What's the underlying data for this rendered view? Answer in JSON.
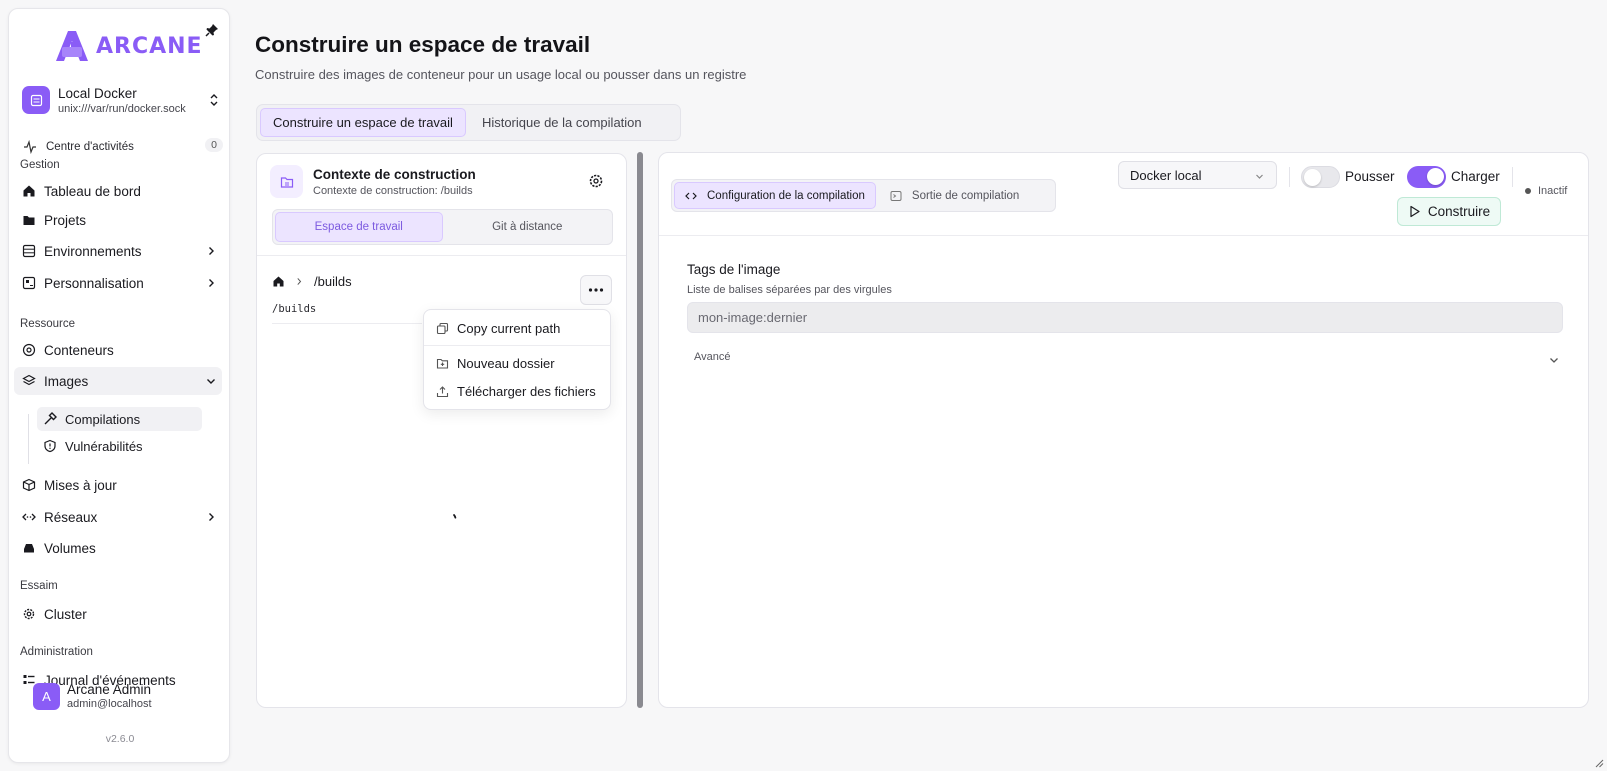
{
  "app": {
    "logo_text": "ARCANE",
    "brand_color": "#8a5cf6"
  },
  "sidebar": {
    "environment": {
      "name": "Local Docker",
      "socket": "unix:///var/run/docker.sock"
    },
    "activity": {
      "label": "Centre d'activités",
      "count": "0"
    },
    "sections": {
      "gestion": "Gestion",
      "ressource": "Ressource",
      "essaim": "Essaim",
      "administration": "Administration"
    },
    "items": {
      "dashboard": "Tableau de bord",
      "projects": "Projets",
      "environments": "Environnements",
      "customization": "Personnalisation",
      "containers": "Conteneurs",
      "images": "Images",
      "builds": "Compilations",
      "vulnerabilities": "Vulnérabilités",
      "updates": "Mises à jour",
      "networks": "Réseaux",
      "volumes": "Volumes",
      "cluster": "Cluster",
      "events": "Journal d'événements"
    },
    "user": {
      "initial": "A",
      "name": "Arcane Admin",
      "email": "admin@localhost"
    },
    "version": "v2.6.0"
  },
  "page": {
    "title": "Construire un espace de travail",
    "subtitle": "Construire des images de conteneur pour un usage local ou pousser dans un registre",
    "tabs": [
      "Construire un espace de travail",
      "Historique de la compilation"
    ]
  },
  "context": {
    "title": "Contexte de construction",
    "subtitle": "Contexte de construction: /builds",
    "modes": [
      "Espace de travail",
      "Git à distance"
    ],
    "breadcrumb": "/builds",
    "path": "/builds",
    "menu": [
      "Copy current path",
      "Nouveau dossier",
      "Télécharger des fichiers"
    ]
  },
  "build": {
    "tabs": [
      "Configuration de la compilation",
      "Sortie de compilation"
    ],
    "target": "Docker local",
    "push_label": "Pousser",
    "push_enabled": false,
    "load_label": "Charger",
    "load_enabled": true,
    "status": "Inactif",
    "build_button": "Construire",
    "tags_label": "Tags de l'image",
    "tags_help": "Liste de balises séparées par des virgules",
    "tags_placeholder": "mon-image:dernier",
    "advanced": "Avancé"
  }
}
